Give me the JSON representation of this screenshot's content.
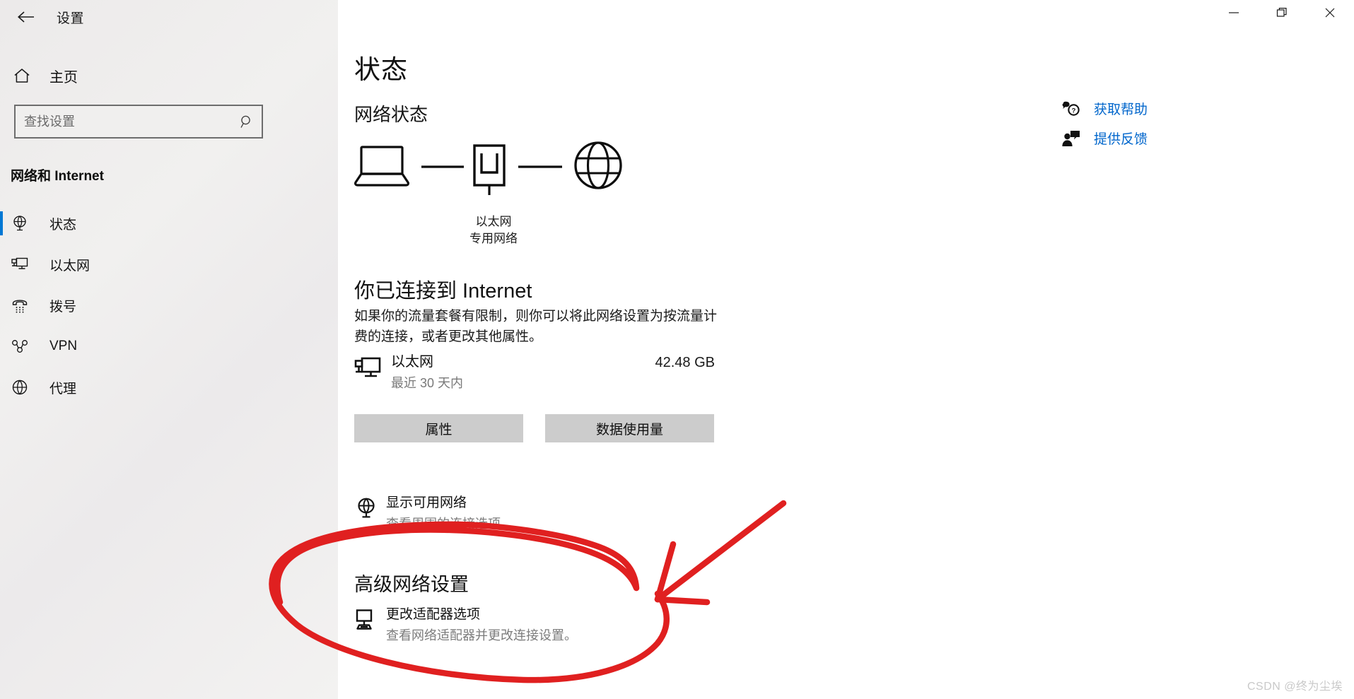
{
  "window": {
    "title": "设置",
    "controls": {
      "minimize": "minimize-icon",
      "maximize": "maximize-icon",
      "close": "close-icon"
    }
  },
  "sidebar": {
    "back_icon": "back-arrow-icon",
    "home": {
      "label": "主页",
      "icon": "home-icon"
    },
    "search": {
      "placeholder": "查找设置",
      "value": "",
      "icon": "search-icon"
    },
    "category": "网络和 Internet",
    "items": [
      {
        "label": "状态",
        "icon": "globe-status-icon",
        "selected": true
      },
      {
        "label": "以太网",
        "icon": "ethernet-icon",
        "selected": false
      },
      {
        "label": "拨号",
        "icon": "dialup-phone-icon",
        "selected": false
      },
      {
        "label": "VPN",
        "icon": "vpn-icon",
        "selected": false
      },
      {
        "label": "代理",
        "icon": "proxy-globe-icon",
        "selected": false
      }
    ]
  },
  "main": {
    "page_title": "状态",
    "section_title": "网络状态",
    "diagram": {
      "device_icon": "laptop-icon",
      "router_icon": "network-adapter-icon",
      "internet_icon": "globe-icon",
      "caption_line1": "以太网",
      "caption_line2": "专用网络"
    },
    "connection": {
      "title": "你已连接到 Internet",
      "description": "如果你的流量套餐有限制，则你可以将此网络设置为按流量计费的连接，或者更改其他属性。"
    },
    "usage": {
      "icon": "ethernet-monitor-icon",
      "name": "以太网",
      "period": "最近 30 天内",
      "amount": "42.48 GB"
    },
    "buttons": {
      "properties": "属性",
      "data_usage": "数据使用量"
    },
    "show_available": {
      "icon": "globe-network-icon",
      "title": "显示可用网络",
      "subtitle": "查看周围的连接选项。"
    },
    "advanced_heading": "高级网络设置",
    "change_adapter": {
      "icon": "adapter-monitor-icon",
      "title": "更改适配器选项",
      "subtitle": "查看网络适配器并更改连接设置。"
    }
  },
  "help": {
    "items": [
      {
        "label": "获取帮助",
        "icon": "help-question-icon"
      },
      {
        "label": "提供反馈",
        "icon": "feedback-person-icon"
      }
    ]
  },
  "annotation": {
    "color": "#e02020",
    "shapes": [
      "ellipse-highlight",
      "arrow-pointer"
    ]
  },
  "watermark": "CSDN @终为尘埃"
}
